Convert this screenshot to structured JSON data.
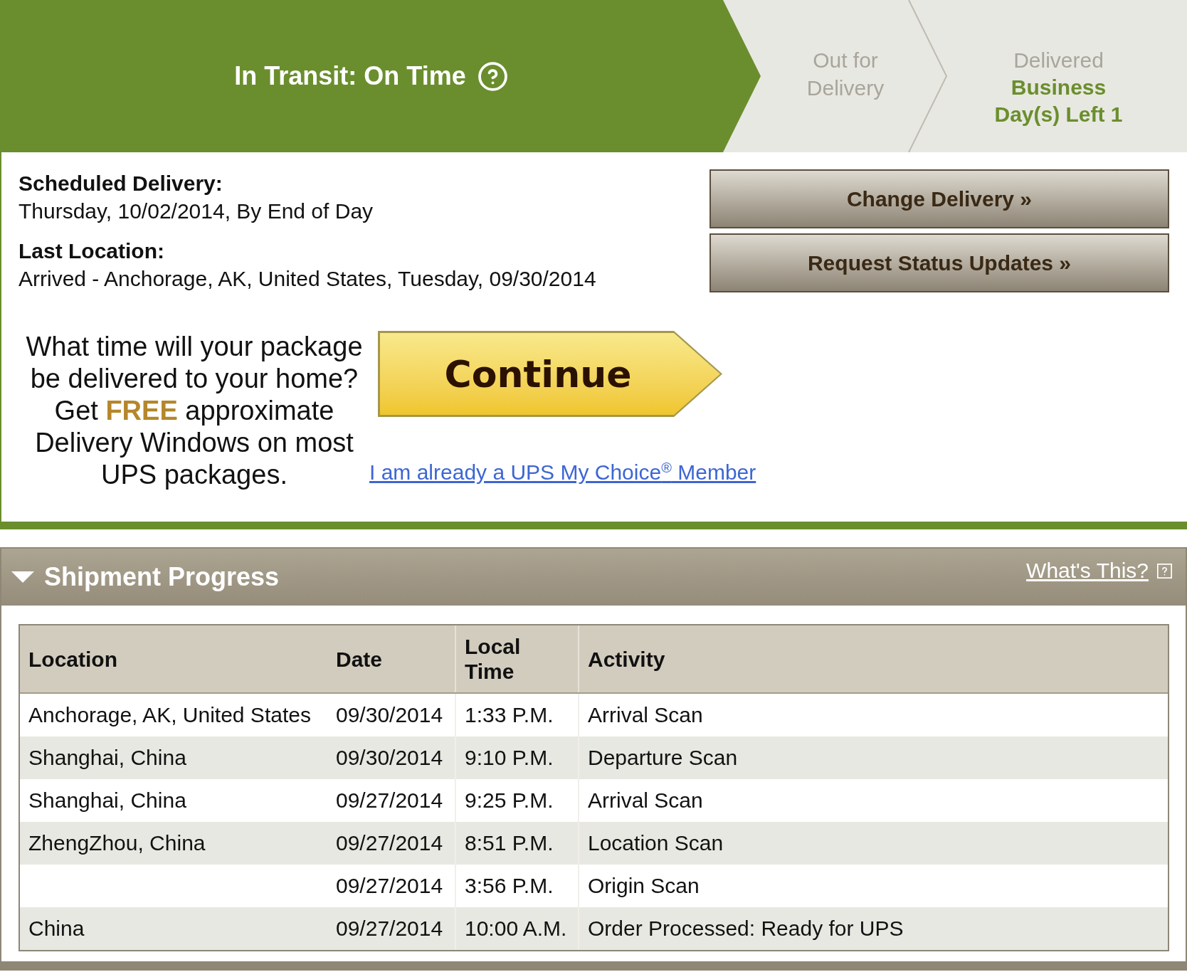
{
  "progress_steps": [
    {
      "label": "In Transit: On Time",
      "selected": true
    },
    {
      "label": "Out for Delivery",
      "selected": false
    },
    {
      "label": "Delivered",
      "note": "Business Day(s) Left 1",
      "selected": false
    }
  ],
  "details": [
    {
      "label": "Scheduled Delivery:",
      "value": "Thursday, 10/02/2014, By End of Day"
    },
    {
      "label": "Last Location:",
      "value": "Arrived - Anchorage, AK, United States, Tuesday, 09/30/2014"
    }
  ],
  "actions": [
    "Change Delivery »",
    "Request Status Updates »"
  ],
  "promo": {
    "text": "What time will your package be delivered to your home? Get **FREE** approximate Delivery Windows on most UPS packages.",
    "button": "Continue",
    "link": "I am already a UPS My Choice$^{®}$ Member"
  },
  "shipment_progress": {
    "title": "Shipment Progress",
    "expanded": true,
    "help_link": "What's This?",
    "table": {
      "columns": [
        "Location",
        "Date",
        "Local Time",
        "Activity"
      ],
      "rows": [
        {
          "location": "Anchorage, AK, United States",
          "date": "09/30/2014",
          "local_time": "1:33 P.M.",
          "activity": "Arrival Scan"
        },
        {
          "location": "Shanghai, China",
          "date": "09/30/2014",
          "local_time": "9:10 P.M.",
          "activity": "Departure Scan"
        },
        {
          "location": "Shanghai, China",
          "date": "09/27/2014",
          "local_time": "9:25 P.M.",
          "activity": "Arrival Scan"
        },
        {
          "location": "ZhengZhou, China",
          "date": "09/27/2014",
          "local_time": "8:51 P.M.",
          "activity": "Location Scan"
        },
        {
          "date": "09/27/2014",
          "local_time": "3:56 P.M.",
          "activity": "Origin Scan"
        },
        {
          "location": "China",
          "date": "09/27/2014",
          "local_time": "10:00 A.M.",
          "activity": "Order Processed: Ready for UPS"
        }
      ]
    }
  }
}
